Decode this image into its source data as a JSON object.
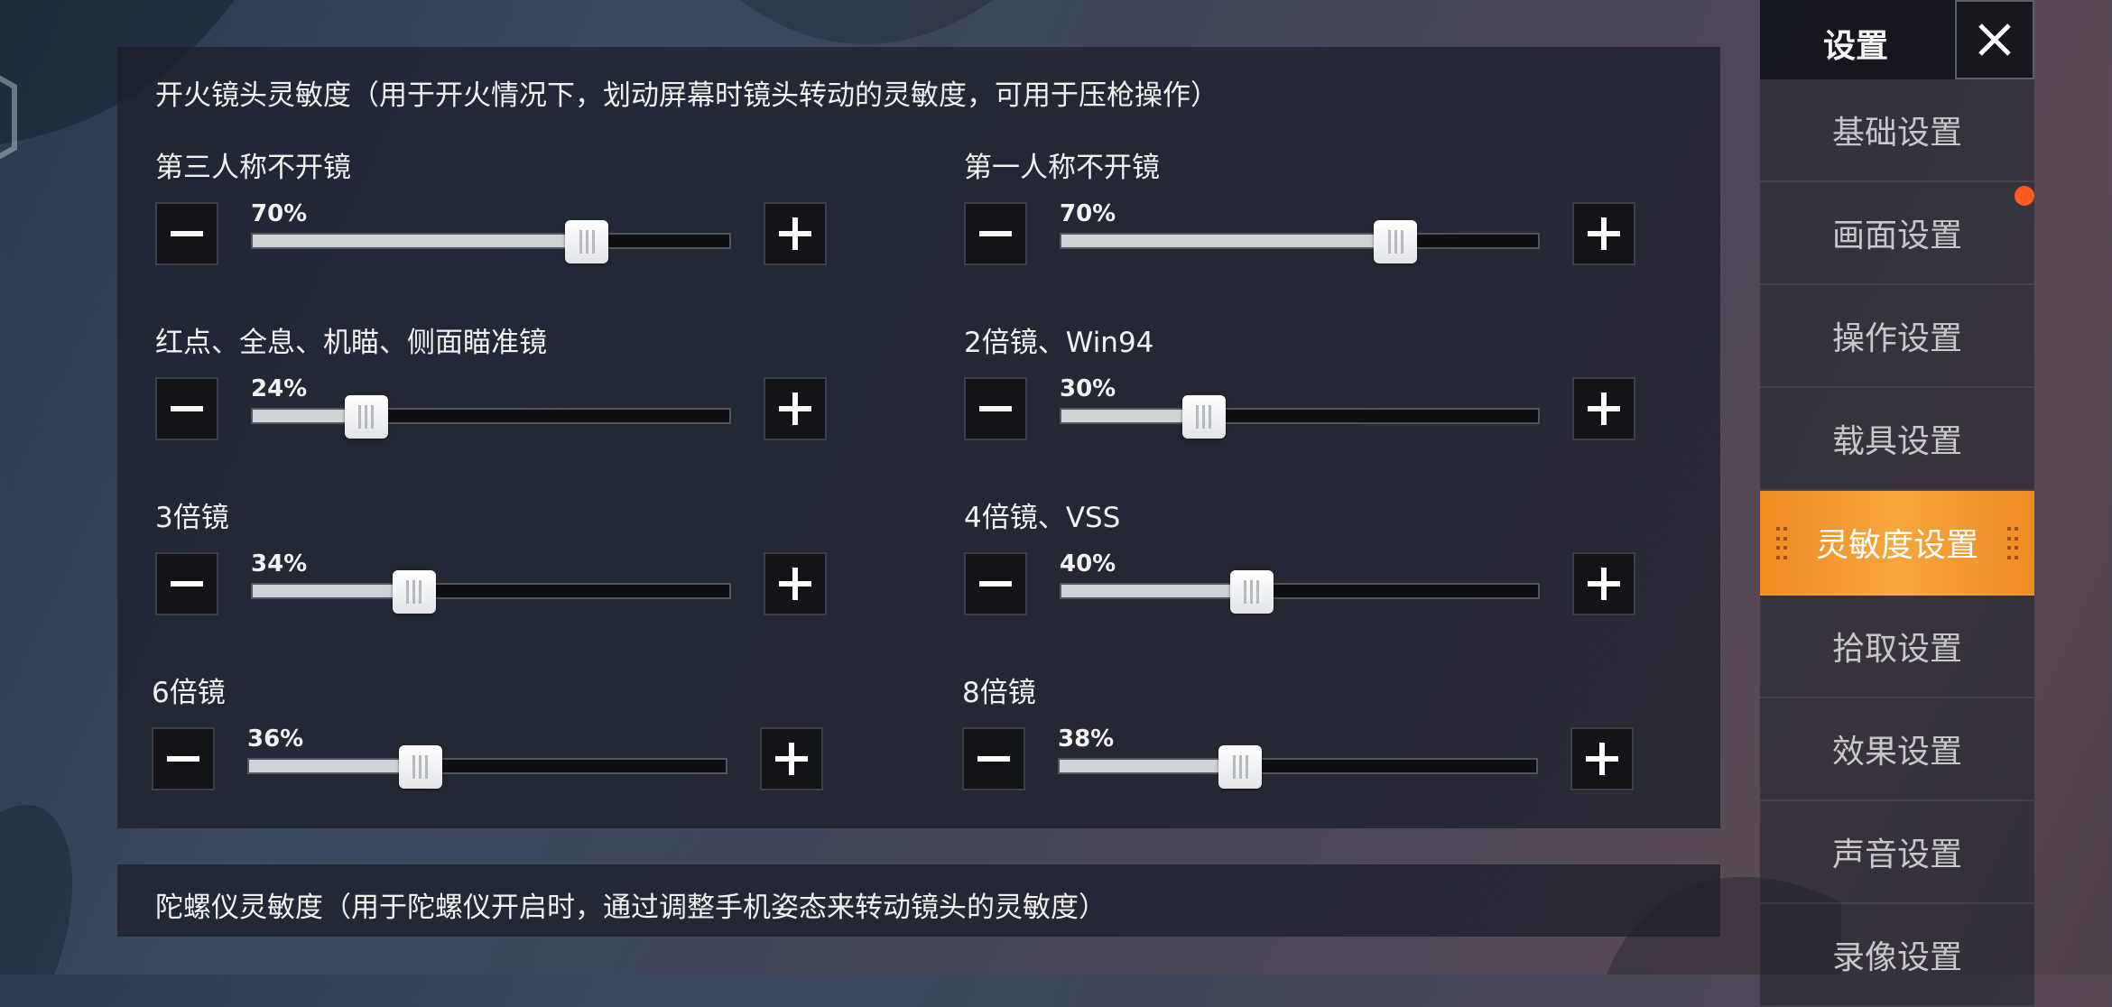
{
  "colors": {
    "accent": "#f6a63c",
    "badge": "#ff5a1f"
  },
  "panel": {
    "title": "开火镜头灵敏度（用于开火情况下，划动屏幕时镜头转动的灵敏度，可用于压枪操作）",
    "groups": [
      {
        "label": "第三人称不开镜",
        "value": 70,
        "value_text": "70%"
      },
      {
        "label": "第一人称不开镜",
        "value": 70,
        "value_text": "70%"
      },
      {
        "label": "红点、全息、机瞄、侧面瞄准镜",
        "value": 24,
        "value_text": "24%"
      },
      {
        "label": "2倍镜、Win94",
        "value": 30,
        "value_text": "30%"
      },
      {
        "label": "3倍镜",
        "value": 34,
        "value_text": "34%"
      },
      {
        "label": "4倍镜、VSS",
        "value": 40,
        "value_text": "40%"
      },
      {
        "label": "6倍镜",
        "value": 36,
        "value_text": "36%"
      },
      {
        "label": "8倍镜",
        "value": 38,
        "value_text": "38%"
      }
    ]
  },
  "panel2": {
    "title": "陀螺仪灵敏度（用于陀螺仪开启时，通过调整手机姿态来转动镜头的灵敏度）"
  },
  "sidebar": {
    "title": "设置",
    "items": [
      {
        "label": "基础设置",
        "active": false
      },
      {
        "label": "画面设置",
        "active": false,
        "badge": true
      },
      {
        "label": "操作设置",
        "active": false
      },
      {
        "label": "载具设置",
        "active": false
      },
      {
        "label": "灵敏度设置",
        "active": true
      },
      {
        "label": "拾取设置",
        "active": false
      },
      {
        "label": "效果设置",
        "active": false
      },
      {
        "label": "声音设置",
        "active": false
      },
      {
        "label": "录像设置",
        "active": false
      }
    ]
  }
}
